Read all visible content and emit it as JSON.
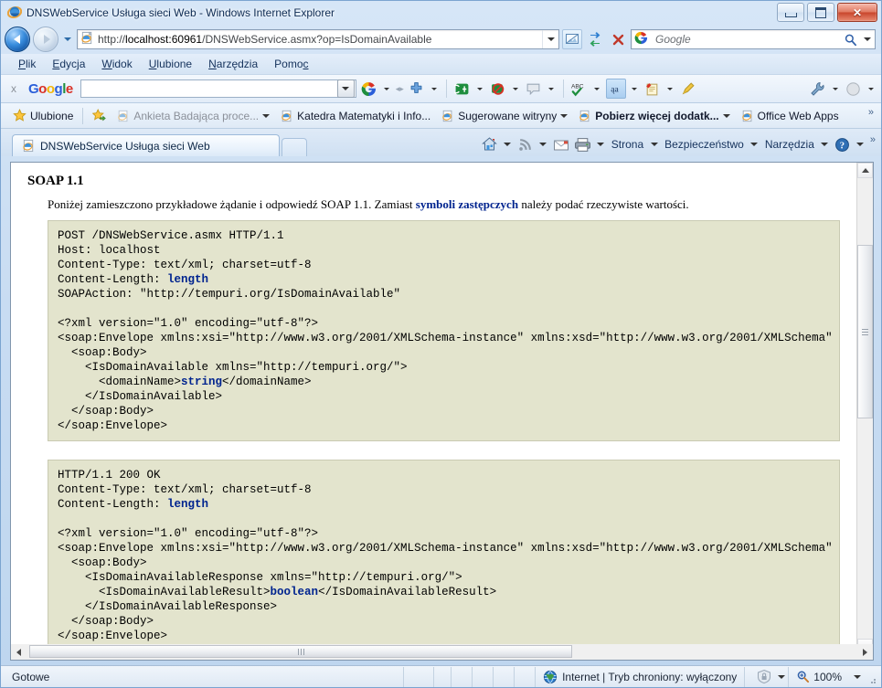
{
  "window": {
    "title": "DNSWebService Usługa sieci Web - Windows Internet Explorer",
    "minimize_label": "Minimalizuj",
    "maximize_label": "Maksymalizuj",
    "close_label": "Zamknij"
  },
  "navigation": {
    "back_label": "Wstecz",
    "forward_label": "Dalej",
    "history_label": "Ostatnie strony",
    "url": "http://localhost:60961/DNSWebService.asmx?op=IsDomainAvailable",
    "url_scheme": "http://",
    "url_host": "localhost:60961",
    "url_path": "/DNSWebService.asmx?op=IsDomainAvailable",
    "compat_label": "Widok zgodności",
    "refresh_label": "Odśwież",
    "stop_label": "Zatrzymaj",
    "search_placeholder": "Google",
    "search_value": "",
    "search_go_label": "Szukaj"
  },
  "menubar": {
    "items": [
      {
        "label": "Plik",
        "accel": "P"
      },
      {
        "label": "Edycja",
        "accel": "E"
      },
      {
        "label": "Widok",
        "accel": "W"
      },
      {
        "label": "Ulubione",
        "accel": "U"
      },
      {
        "label": "Narzędzia",
        "accel": "N"
      },
      {
        "label": "Pomoc",
        "accel": "c"
      }
    ]
  },
  "google_toolbar": {
    "close_label": "x",
    "logo": "Google",
    "logo_letters": [
      "G",
      "o",
      "o",
      "g",
      "l",
      "e"
    ],
    "search_value": "",
    "buttons": [
      {
        "name": "google-search-button",
        "glyph": "G"
      },
      {
        "name": "bookmarks-button",
        "glyph": "+"
      },
      {
        "name": "translate-button",
        "glyph": "translate"
      },
      {
        "name": "popup-blocker-button",
        "glyph": "blocked"
      },
      {
        "name": "comments-button",
        "glyph": "comment"
      },
      {
        "name": "spellcheck-button",
        "glyph": "ABC"
      },
      {
        "name": "autofill-button",
        "glyph": "aa"
      },
      {
        "name": "notebook-button",
        "glyph": "notes"
      },
      {
        "name": "highlight-button",
        "glyph": "pencil"
      },
      {
        "name": "settings-button",
        "glyph": "wrench"
      },
      {
        "name": "account-button",
        "glyph": "avatar"
      }
    ]
  },
  "favorites_bar": {
    "title": "Ulubione",
    "add_label": "Dodaj do paska Ulubione",
    "items": [
      {
        "label": "Ankieta Badająca proce...",
        "has_caret": true,
        "dim": true,
        "bold": false
      },
      {
        "label": "Katedra Matematyki i Info...",
        "has_caret": false,
        "dim": false,
        "bold": false
      },
      {
        "label": "Sugerowane witryny",
        "has_caret": true,
        "dim": false,
        "bold": false
      },
      {
        "label": "Pobierz więcej dodatk...",
        "has_caret": true,
        "dim": false,
        "bold": true
      },
      {
        "label": "Office Web Apps",
        "has_caret": false,
        "dim": false,
        "bold": false
      }
    ],
    "overflow": "»"
  },
  "tabs": {
    "items": [
      {
        "label": "DNSWebService Usługa sieci Web",
        "active": true
      }
    ],
    "new_tab_label": "Nowa karta"
  },
  "command_bar": {
    "home_label": "Strona główna",
    "feeds_label": "Kanały informacyjne",
    "mail_label": "Poczta",
    "print_label": "Drukuj",
    "items": [
      {
        "label": "Strona",
        "accel": "ro",
        "name": "page-menu"
      },
      {
        "label": "Bezpieczeństwo",
        "accel": "B",
        "name": "security-menu"
      },
      {
        "label": "Narzędzia",
        "accel": "z",
        "name": "tools-menu"
      }
    ],
    "help_label": "Pomoc",
    "overflow": "»"
  },
  "page": {
    "heading": "SOAP 1.1",
    "intro_before": "Poniżej zamieszczono przykładowe żądanie i odpowiedź SOAP 1.1. Zamiast ",
    "intro_emphasis": "symboli zastępczych",
    "intro_after": " należy podać rzeczywiste wartości.",
    "request_block": {
      "lines": [
        {
          "text": "POST /DNSWebService.asmx HTTP/1.1"
        },
        {
          "text": "Host: localhost"
        },
        {
          "text": "Content-Type: text/xml; charset=utf-8"
        },
        {
          "text": "Content-Length: ",
          "bold": "length",
          "after": ""
        },
        {
          "text": "SOAPAction: \"http://tempuri.org/IsDomainAvailable\""
        },
        {
          "text": ""
        },
        {
          "text": "<?xml version=\"1.0\" encoding=\"utf-8\"?>"
        },
        {
          "text": "<soap:Envelope xmlns:xsi=\"http://www.w3.org/2001/XMLSchema-instance\" xmlns:xsd=\"http://www.w3.org/2001/XMLSchema\" xmlns:soap=\"http://schemas.xmlsoap.org/soap/envelope/\">"
        },
        {
          "text": "  <soap:Body>"
        },
        {
          "text": "    <IsDomainAvailable xmlns=\"http://tempuri.org/\">"
        },
        {
          "text": "      <domainName>",
          "bold": "string",
          "after": "</domainName>"
        },
        {
          "text": "    </IsDomainAvailable>"
        },
        {
          "text": "  </soap:Body>"
        },
        {
          "text": "</soap:Envelope>"
        }
      ]
    },
    "response_block": {
      "lines": [
        {
          "text": "HTTP/1.1 200 OK"
        },
        {
          "text": "Content-Type: text/xml; charset=utf-8"
        },
        {
          "text": "Content-Length: ",
          "bold": "length",
          "after": ""
        },
        {
          "text": ""
        },
        {
          "text": "<?xml version=\"1.0\" encoding=\"utf-8\"?>"
        },
        {
          "text": "<soap:Envelope xmlns:xsi=\"http://www.w3.org/2001/XMLSchema-instance\" xmlns:xsd=\"http://www.w3.org/2001/XMLSchema\" xmlns:soap=\"http://schemas.xmlsoap.org/soap/envelope/\">"
        },
        {
          "text": "  <soap:Body>"
        },
        {
          "text": "    <IsDomainAvailableResponse xmlns=\"http://tempuri.org/\">"
        },
        {
          "text": "      <IsDomainAvailableResult>",
          "bold": "boolean",
          "after": "</IsDomainAvailableResult>"
        },
        {
          "text": "    </IsDomainAvailableResponse>"
        },
        {
          "text": "  </soap:Body>"
        },
        {
          "text": "</soap:Envelope>"
        }
      ]
    }
  },
  "status_bar": {
    "status": "Gotowe",
    "zone": "Internet | Tryb chroniony: wyłączony",
    "zoom": "100%"
  },
  "colors": {
    "code_bg": "#e3e4cd",
    "code_border": "#c9cab2",
    "placeholder_blue": "#00248f",
    "frame_blue": "#7ba4d0",
    "close_red": "#c9452c"
  }
}
